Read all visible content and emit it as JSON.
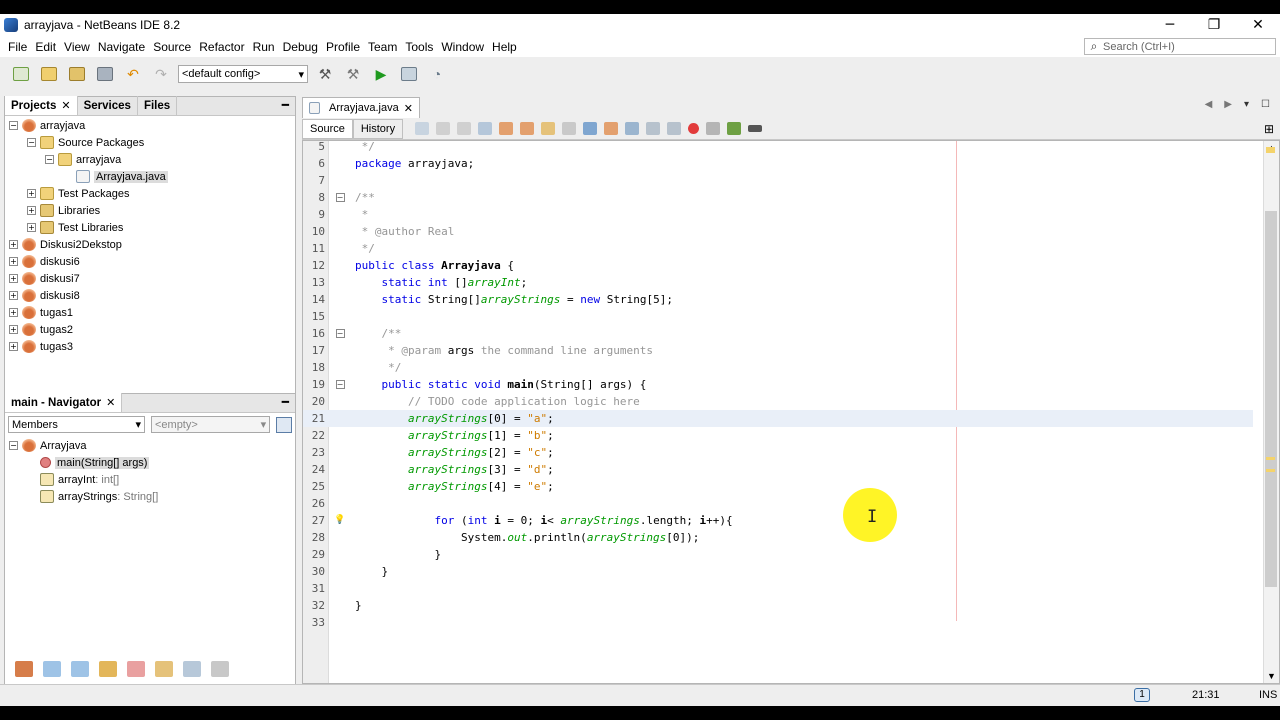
{
  "window": {
    "title": "arrayjava - NetBeans IDE 8.2",
    "controls": [
      "─",
      "❐",
      "✕"
    ]
  },
  "menu": [
    "File",
    "Edit",
    "View",
    "Navigate",
    "Source",
    "Refactor",
    "Run",
    "Debug",
    "Profile",
    "Team",
    "Tools",
    "Window",
    "Help"
  ],
  "search": {
    "placeholder": "Search (Ctrl+I)"
  },
  "toolbar": {
    "config": "<default config>"
  },
  "projects": {
    "tabs": [
      "Projects",
      "Services",
      "Files"
    ],
    "tree": [
      {
        "label": "arrayjava",
        "depth": 0,
        "exp": "−",
        "icon": "cup"
      },
      {
        "label": "Source Packages",
        "depth": 1,
        "exp": "−",
        "icon": "pkg"
      },
      {
        "label": "arrayjava",
        "depth": 2,
        "exp": "−",
        "icon": "pkg"
      },
      {
        "label": "Arrayjava.java",
        "depth": 3,
        "exp": "",
        "icon": "file",
        "selected": true
      },
      {
        "label": "Test Packages",
        "depth": 1,
        "exp": "+",
        "icon": "pkg"
      },
      {
        "label": "Libraries",
        "depth": 1,
        "exp": "+",
        "icon": "lib"
      },
      {
        "label": "Test Libraries",
        "depth": 1,
        "exp": "+",
        "icon": "lib"
      },
      {
        "label": "Diskusi2Dekstop",
        "depth": 0,
        "exp": "+",
        "icon": "cup"
      },
      {
        "label": "diskusi6",
        "depth": 0,
        "exp": "+",
        "icon": "cup"
      },
      {
        "label": "diskusi7",
        "depth": 0,
        "exp": "+",
        "icon": "cup"
      },
      {
        "label": "diskusi8",
        "depth": 0,
        "exp": "+",
        "icon": "cup"
      },
      {
        "label": "tugas1",
        "depth": 0,
        "exp": "+",
        "icon": "cup"
      },
      {
        "label": "tugas2",
        "depth": 0,
        "exp": "+",
        "icon": "cup"
      },
      {
        "label": "tugas3",
        "depth": 0,
        "exp": "+",
        "icon": "cup"
      }
    ]
  },
  "navigator": {
    "title": "main - Navigator",
    "filter": "Members",
    "empty": "<empty>",
    "tree": [
      {
        "label": "Arrayjava",
        "type": "",
        "depth": 0,
        "icon": "cup",
        "exp": "−"
      },
      {
        "label": "main(String[] args)",
        "type": "",
        "depth": 1,
        "icon": "meth",
        "selected": true
      },
      {
        "label": "arrayInt",
        "type": " : int[]",
        "depth": 1,
        "icon": "fld"
      },
      {
        "label": "arrayStrings",
        "type": " : String[]",
        "depth": 1,
        "icon": "fld"
      }
    ]
  },
  "editor": {
    "tab": "Arrayjava.java",
    "source": "Source",
    "history": "History",
    "lines": [
      {
        "n": "5",
        "html": "<span class='cm'> */</span>"
      },
      {
        "n": "6",
        "html": "<span class='kw'>package</span> arrayjava;"
      },
      {
        "n": "7",
        "html": ""
      },
      {
        "n": "8",
        "fold": "−",
        "html": "<span class='cm'>/**</span>"
      },
      {
        "n": "9",
        "html": "<span class='cm'> *</span>"
      },
      {
        "n": "10",
        "html": "<span class='cm'> * @author Real</span>"
      },
      {
        "n": "11",
        "html": "<span class='cm'> */</span>"
      },
      {
        "n": "12",
        "html": "<span class='kw'>public class</span> <span class='bold'>Arrayjava</span> {"
      },
      {
        "n": "13",
        "html": "    <span class='kw'>static int</span> []<span class='fldc'>arrayInt</span>;"
      },
      {
        "n": "14",
        "html": "    <span class='kw'>static</span> String[]<span class='fldc'>arrayStrings</span> = <span class='kw'>new</span> String[5];"
      },
      {
        "n": "15",
        "html": ""
      },
      {
        "n": "16",
        "fold": "−",
        "html": "    <span class='cm'>/**</span>"
      },
      {
        "n": "17",
        "html": "<span class='cm'>     * @param </span>args<span class='cm'> the command line arguments</span>"
      },
      {
        "n": "18",
        "html": "<span class='cm'>     */</span>"
      },
      {
        "n": "19",
        "fold": "−",
        "html": "    <span class='kw'>public static void</span> <span class='bold'>main</span>(String[] args) {"
      },
      {
        "n": "20",
        "html": "        <span class='cm'>// TODO code application logic here</span>"
      },
      {
        "n": "21",
        "hl": true,
        "html": "        <span class='fldc'>arrayStrings</span>[0] = <span class='str'>\"a\"</span>;"
      },
      {
        "n": "22",
        "html": "        <span class='fldc'>arrayStrings</span>[1] = <span class='str'>\"b\"</span>;"
      },
      {
        "n": "23",
        "html": "        <span class='fldc'>arrayStrings</span>[2] = <span class='str'>\"c\"</span>;"
      },
      {
        "n": "24",
        "html": "        <span class='fldc'>arrayStrings</span>[3] = <span class='str'>\"d\"</span>;"
      },
      {
        "n": "25",
        "html": "        <span class='fldc'>arrayStrings</span>[4] = <span class='str'>\"e\"</span>;"
      },
      {
        "n": "26",
        "html": ""
      },
      {
        "n": "27",
        "warn": true,
        "html": "            <span class='kw'>for</span> (<span class='kw'>int</span> <span class='bold'>i</span> = 0; <span class='bold'>i</span>&lt; <span class='fldc'>arrayStrings</span>.length; <span class='bold'>i</span>++){"
      },
      {
        "n": "28",
        "html": "                System.<span class='fldc'>out</span>.println(<span class='fldc'>arrayStrings</span>[0]);"
      },
      {
        "n": "29",
        "html": "            }"
      },
      {
        "n": "30",
        "html": "    }"
      },
      {
        "n": "31",
        "html": ""
      },
      {
        "n": "32",
        "html": "}"
      },
      {
        "n": "33",
        "html": ""
      }
    ]
  },
  "status": {
    "position": "21:31",
    "mode": "INS",
    "notifications": "1"
  }
}
